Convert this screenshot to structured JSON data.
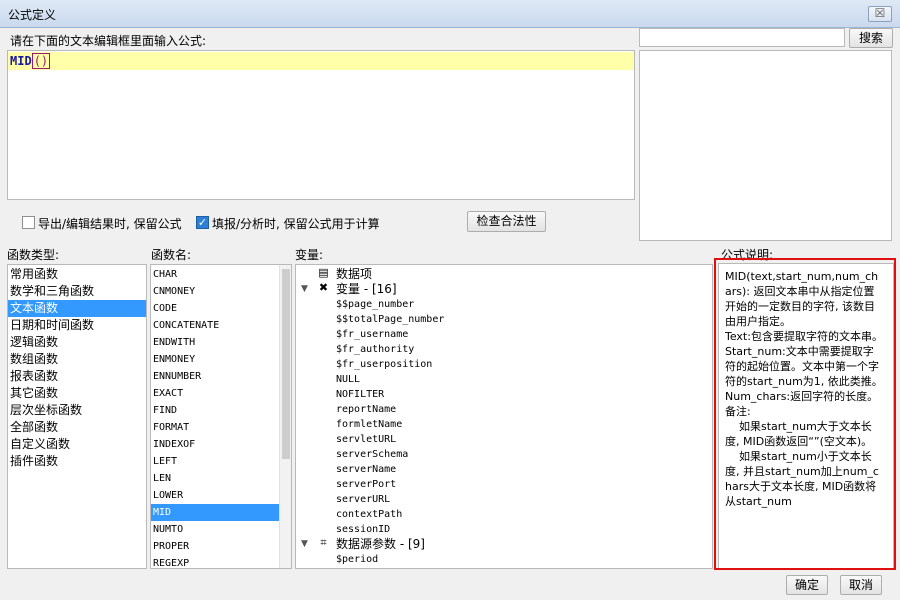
{
  "window": {
    "title": "公式定义",
    "close_label": "☒"
  },
  "editor": {
    "prompt": "请在下面的文本编辑框里面输入公式:",
    "func_text": "MID",
    "paren_text": "()"
  },
  "search": {
    "button_label": "搜索",
    "value": ""
  },
  "options": {
    "preserve_export": {
      "label": "导出/编辑结果时, 保留公式",
      "checked": false
    },
    "preserve_fill": {
      "label": "填报/分析时, 保留公式用于计算",
      "checked": true
    },
    "check_button_label": "检查合法性"
  },
  "function_types": {
    "header": "函数类型:",
    "items": [
      "常用函数",
      "数学和三角函数",
      "文本函数",
      "日期和时间函数",
      "逻辑函数",
      "数组函数",
      "报表函数",
      "其它函数",
      "层次坐标函数",
      "全部函数",
      "自定义函数",
      "插件函数"
    ],
    "selected_index": 2
  },
  "function_names": {
    "header": "函数名:",
    "items": [
      "CHAR",
      "CNMONEY",
      "CODE",
      "CONCATENATE",
      "ENDWITH",
      "ENMONEY",
      "ENNUMBER",
      "EXACT",
      "FIND",
      "FORMAT",
      "INDEXOF",
      "LEFT",
      "LEN",
      "LOWER",
      "MID",
      "NUMTO",
      "PROPER",
      "REGEXP"
    ],
    "selected_index": 14
  },
  "variables": {
    "header": "变量:",
    "data_item": "数据项",
    "var_group": "变量 - [16]",
    "vars": [
      "$$page_number",
      "$$totalPage_number",
      "$fr_username",
      "$fr_authority",
      "$fr_userposition",
      "NULL",
      "NOFILTER",
      "reportName",
      "formletName",
      "servletURL",
      "serverSchema",
      "serverName",
      "serverPort",
      "serverURL",
      "contextPath",
      "sessionID"
    ],
    "param_group": "数据源参数 - [9]",
    "params": [
      "$period"
    ]
  },
  "description": {
    "header": "公式说明:",
    "lines": [
      {
        "t": "MID(text,start_num,num_chars): 返回文本串中从指定位置开始的一定数目的字符, 该数目由用户指定。"
      },
      {
        "t": "Text:包含要提取字符的文本串。"
      },
      {
        "t": "Start_num:文本中需要提取字符的起始位置。文本中第一个字符的start_num为1, 依此类推。"
      },
      {
        "t": "Num_chars:返回字符的长度。"
      },
      {
        "t": "备注:"
      },
      {
        "t": "    如果start_num大于文本长度, MID函数返回“”(空文本)。"
      },
      {
        "t": "    如果start_num小于文本长度, 并且start_num加上num_chars大于文本长度, MID函数将从start_num"
      }
    ]
  },
  "footer": {
    "ok_label": "确定",
    "cancel_label": "取消"
  }
}
